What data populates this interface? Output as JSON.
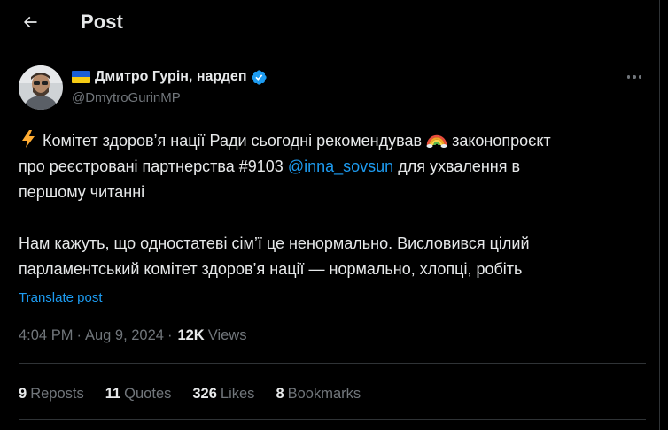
{
  "header": {
    "title": "Post"
  },
  "author": {
    "name": "Дмитро Гурін, нардеп",
    "handle": "@DmytroGurinMP",
    "flag_colors": [
      "#1a5fd6",
      "#f5cc15"
    ],
    "verified_color": "#1d9bf0"
  },
  "tweet": {
    "line1_text": "Комітет здоров’я нації Ради сьогодні рекомендував",
    "line1_text2": "законопроєкт",
    "line2_text": "про реєстровані партнерства #9103",
    "mention": "@inna_sovsun",
    "line2_text2": "для ухвалення в",
    "line3_text": "першому читанні",
    "line4_text": "Нам кажуть, що одностатеві сім’ї це ненормально. Висловився цілий",
    "line5_text": "парламентський комітет здоров’я нації — нормально, хлопці, робіть",
    "emoji_lightning": "lightning-emoji",
    "emoji_rainbow": "rainbow-emoji"
  },
  "translate_label": "Translate post",
  "meta": {
    "time": "4:04 PM",
    "separator": "·",
    "date": "Aug 9, 2024",
    "views_count": "12K",
    "views_label": "Views"
  },
  "stats": [
    {
      "num": "9",
      "label": "Reposts"
    },
    {
      "num": "11",
      "label": "Quotes"
    },
    {
      "num": "326",
      "label": "Likes"
    },
    {
      "num": "8",
      "label": "Bookmarks"
    }
  ],
  "colors": {
    "background": "#000000",
    "text": "#e7e9ea",
    "muted": "#71767b",
    "accent": "#1d9bf0",
    "divider": "#2f3336"
  }
}
